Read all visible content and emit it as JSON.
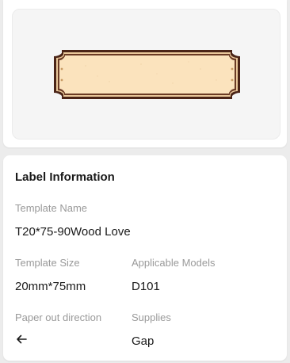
{
  "info": {
    "title": "Label Information",
    "template_name_label": "Template Name",
    "template_name": "T20*75-90Wood Love",
    "template_size_label": "Template Size",
    "template_size": "20mm*75mm",
    "models_label": "Applicable Models",
    "models": "D101",
    "paper_out_label": "Paper out direction",
    "paper_out_icon": "arrow-left-icon",
    "supplies_label": "Supplies",
    "supplies": "Gap"
  },
  "colors": {
    "label_frame": "#4a2417",
    "label_fill": "#fbe3bd",
    "label_accent": "#c79a63"
  }
}
